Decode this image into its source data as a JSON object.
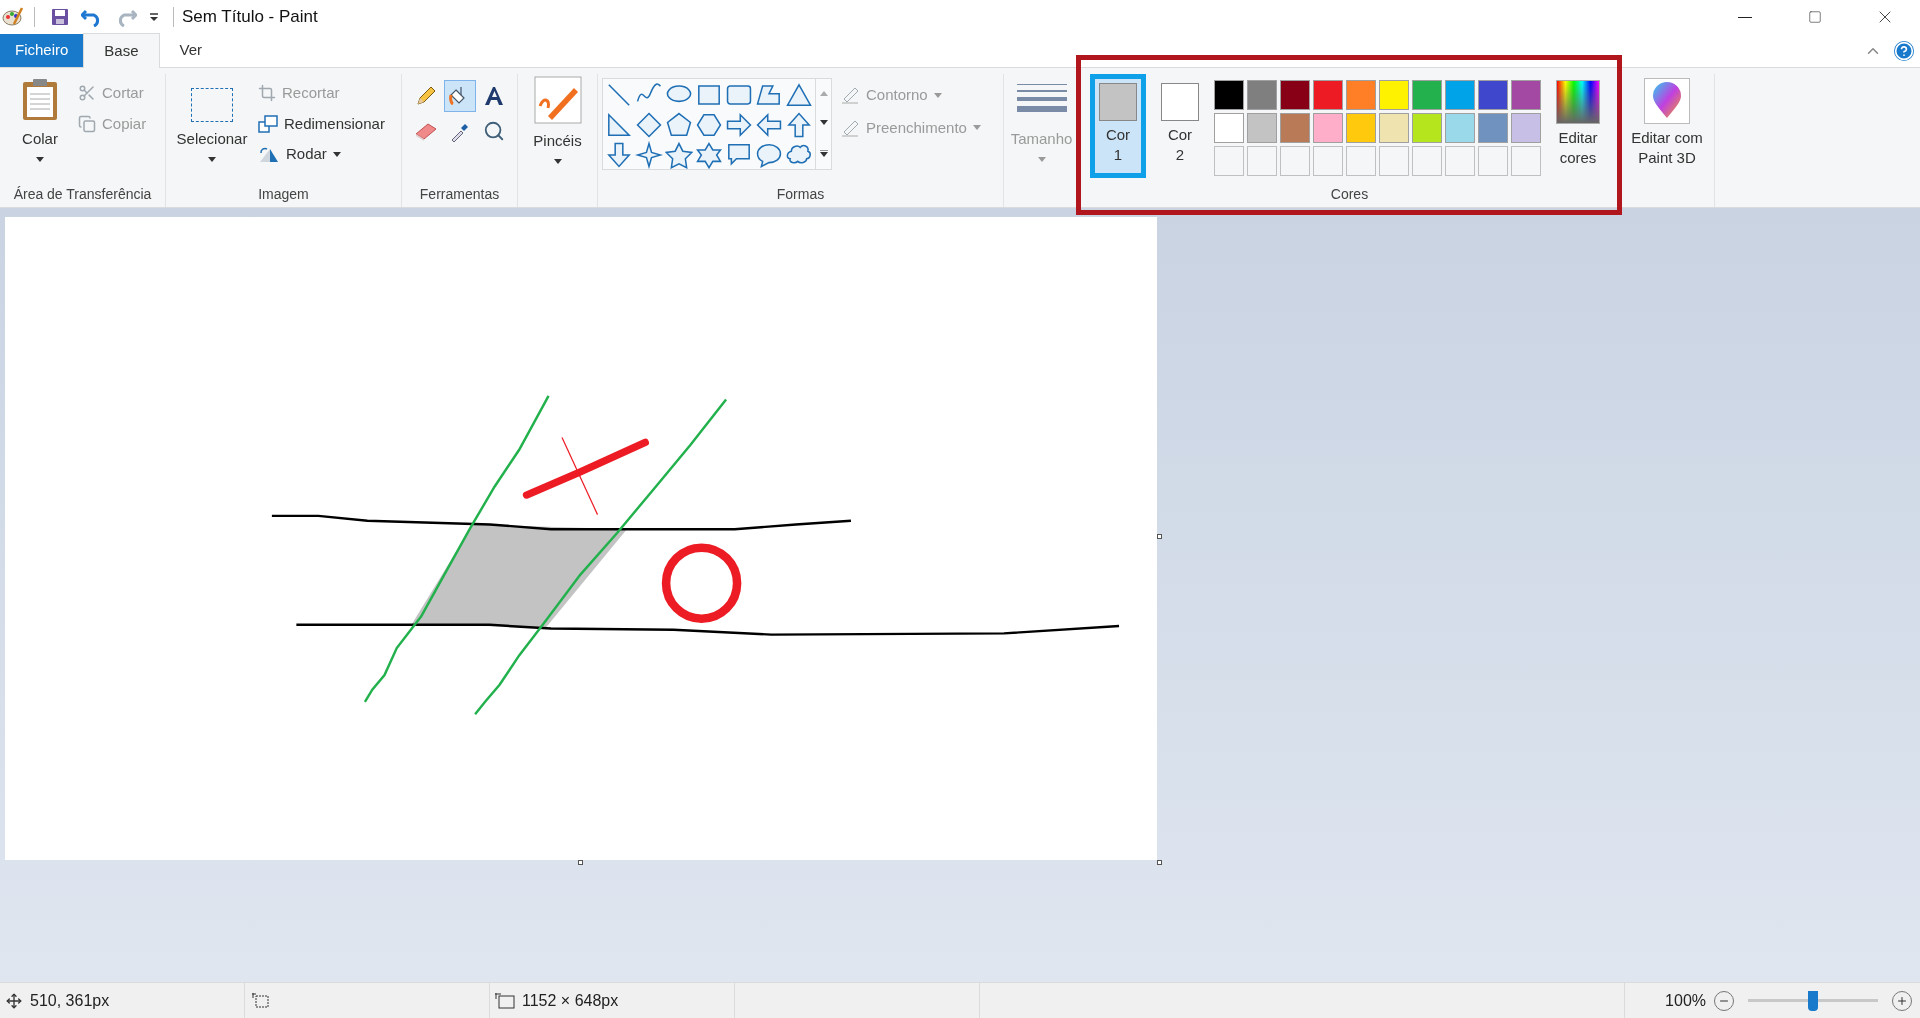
{
  "window": {
    "title": "Sem Título - Paint"
  },
  "file_tab": {
    "label": "Ficheiro"
  },
  "tabs": [
    {
      "label": "Base",
      "selected": true
    },
    {
      "label": "Ver",
      "selected": false
    }
  ],
  "ribbon": {
    "clipboard": {
      "paste": "Colar",
      "actions": [
        {
          "kind": "cut",
          "label": "Cortar",
          "disabled": true
        },
        {
          "kind": "copy",
          "label": "Copiar",
          "disabled": true
        }
      ],
      "group_label": "Área de Transferência"
    },
    "image": {
      "select": "Selecionar",
      "actions": [
        {
          "kind": "crop",
          "label": "Recortar",
          "disabled": true
        },
        {
          "kind": "resize",
          "label": "Redimensionar",
          "disabled": false
        },
        {
          "kind": "rotate",
          "label": "Rodar",
          "disabled": false
        }
      ],
      "group_label": "Imagem"
    },
    "tools": {
      "items": [
        {
          "kind": "pencil",
          "selected": false
        },
        {
          "kind": "fill",
          "selected": true
        },
        {
          "kind": "text",
          "selected": false
        },
        {
          "kind": "eraser",
          "selected": false
        },
        {
          "kind": "picker",
          "selected": false
        },
        {
          "kind": "magnifier",
          "selected": false
        }
      ],
      "group_label": "Ferramentas"
    },
    "brushes": {
      "label": "Pincéis"
    },
    "shapes": {
      "outline": {
        "label": "Contorno",
        "disabled": true
      },
      "fill": {
        "label": "Preenchimento",
        "disabled": true
      },
      "group_label": "Formas"
    },
    "size": {
      "label": "Tamanho",
      "disabled": true
    },
    "colors": {
      "slots": [
        {
          "label": "Cor 1",
          "color": "#c3c3c3",
          "selected": true
        },
        {
          "label": "Cor 2",
          "color": "#ffffff",
          "selected": false
        }
      ],
      "swatches": [
        {
          "color": "#000000"
        },
        {
          "color": "#7f7f7f"
        },
        {
          "color": "#880015"
        },
        {
          "color": "#ed1c24"
        },
        {
          "color": "#ff7f27"
        },
        {
          "color": "#fff200"
        },
        {
          "color": "#22b14c"
        },
        {
          "color": "#00a2e8"
        },
        {
          "color": "#3f48cc"
        },
        {
          "color": "#a349a4"
        },
        {
          "color": "#ffffff"
        },
        {
          "color": "#c3c3c3"
        },
        {
          "color": "#b97a57"
        },
        {
          "color": "#ffaec9"
        },
        {
          "color": "#ffc90e"
        },
        {
          "color": "#efe4b0"
        },
        {
          "color": "#b5e61d"
        },
        {
          "color": "#99d9ea"
        },
        {
          "color": "#7092be"
        },
        {
          "color": "#c8bfe7"
        }
      ],
      "edit_colors": "Editar cores",
      "group_label": "Cores"
    },
    "paint3d": {
      "label": "Editar com Paint 3D"
    }
  },
  "status_bar": {
    "cursor": "510, 361px",
    "canvas_size": "1152 × 648px",
    "zoom": "100%",
    "zoom_slider": {
      "level": 0.5
    }
  }
}
